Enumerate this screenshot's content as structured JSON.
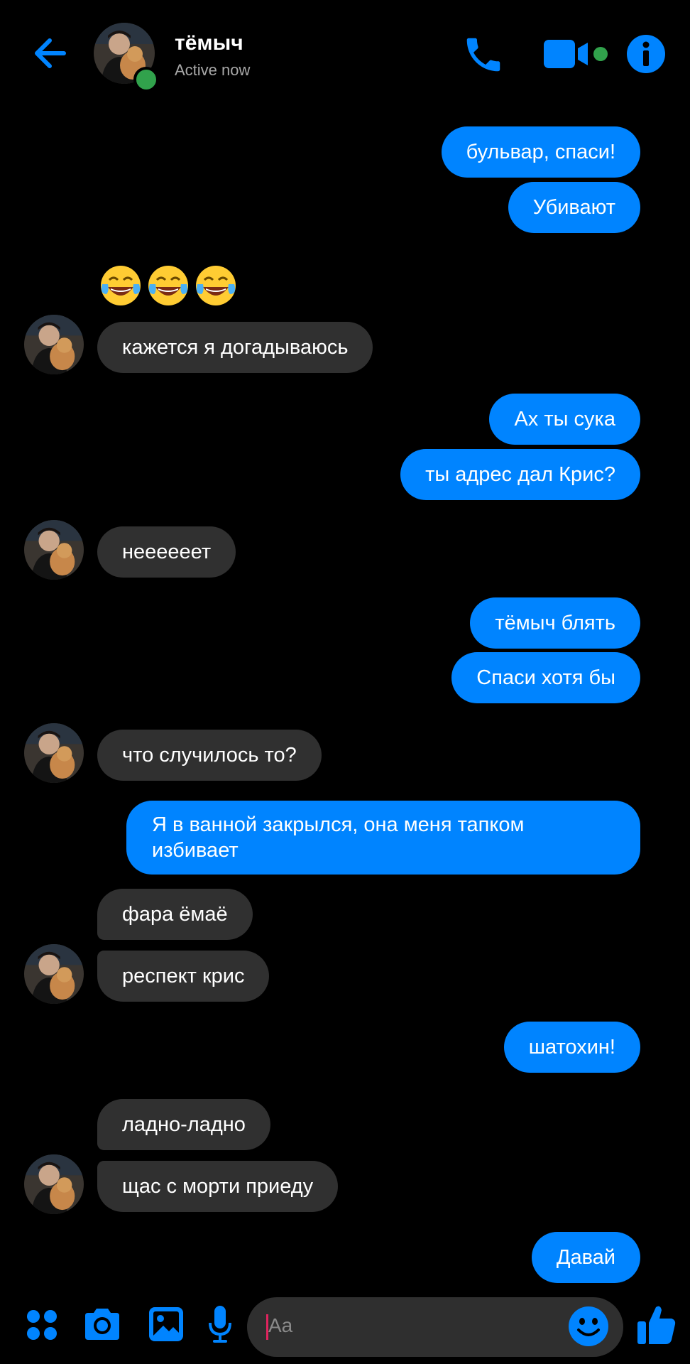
{
  "header": {
    "contact_name": "тёмыч",
    "status": "Active now"
  },
  "colors": {
    "accent": "#0084ff",
    "incoming_bubble": "#303030",
    "online": "#31a24c",
    "background": "#000000"
  },
  "messages": [
    {
      "from": "me",
      "text": "бульвар, спаси!"
    },
    {
      "from": "me",
      "text": "Убивают"
    },
    {
      "from": "them",
      "text": "😂😂😂",
      "type": "emoji"
    },
    {
      "from": "them",
      "text": "кажется я догадываюсь"
    },
    {
      "from": "me",
      "text": "Ах ты сука"
    },
    {
      "from": "me",
      "text": "ты адрес дал Крис?"
    },
    {
      "from": "them",
      "text": "неееееет"
    },
    {
      "from": "me",
      "text": "тёмыч блять"
    },
    {
      "from": "me",
      "text": "Спаси хотя бы"
    },
    {
      "from": "them",
      "text": "что случилось то?"
    },
    {
      "from": "me",
      "text_line1": "Я в ванной закрылся, она меня тапком",
      "text_line2": "избивает"
    },
    {
      "from": "them",
      "text": "фара ёмаё"
    },
    {
      "from": "them",
      "text": "респект крис"
    },
    {
      "from": "me",
      "text": "шатохин!"
    },
    {
      "from": "them",
      "text": "ладно-ладно"
    },
    {
      "from": "them",
      "text": "щас с морти приеду"
    },
    {
      "from": "me",
      "text": "Давай"
    }
  ],
  "composer": {
    "placeholder": "Aa",
    "icons": [
      "apps-icon",
      "camera-icon",
      "gallery-icon",
      "microphone-icon",
      "emoji-icon",
      "like-icon"
    ]
  },
  "header_icons": [
    "back-arrow-icon",
    "phone-icon",
    "video-camera-icon",
    "info-icon"
  ]
}
